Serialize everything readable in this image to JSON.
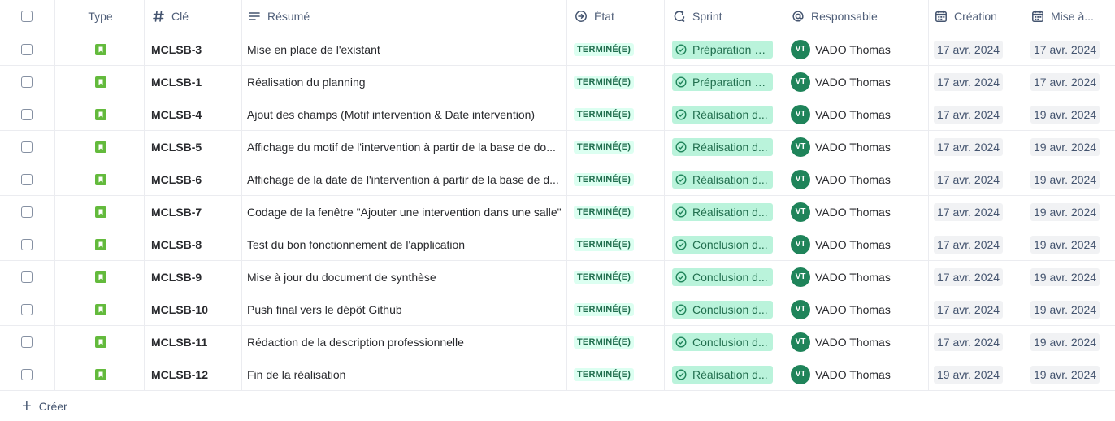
{
  "headers": {
    "type": "Type",
    "key": "Clé",
    "summary": "Résumé",
    "state": "État",
    "sprint": "Sprint",
    "assignee": "Responsable",
    "created": "Création",
    "updated": "Mise à..."
  },
  "icons": {
    "type": "story-icon",
    "key": "hash-icon",
    "summary": "text-lines-icon",
    "state": "arrow-circle-icon",
    "sprint": "sprint-cycle-icon",
    "assignee": "at-icon",
    "created": "calendar-icon",
    "updated": "calendar-icon"
  },
  "colors": {
    "story_green": "#63ba3c",
    "done_lozenge_bg": "#dcfff1",
    "done_lozenge_text": "#216e4e",
    "sprint_pill_bg": "#baf3db",
    "avatar_bg": "#1f845a"
  },
  "rows": [
    {
      "key": "MCLSB-3",
      "summary": "Mise en place de l'existant",
      "state": "TERMINÉ(E)",
      "sprint": "Préparation à...",
      "avatar": "VT",
      "assignee": "VADO Thomas",
      "created": "17 avr. 2024",
      "updated": "17 avr. 2024"
    },
    {
      "key": "MCLSB-1",
      "summary": "Réalisation du planning",
      "state": "TERMINÉ(E)",
      "sprint": "Préparation à...",
      "avatar": "VT",
      "assignee": "VADO Thomas",
      "created": "17 avr. 2024",
      "updated": "17 avr. 2024"
    },
    {
      "key": "MCLSB-4",
      "summary": "Ajout des champs (Motif intervention & Date intervention)",
      "state": "TERMINÉ(E)",
      "sprint": "Réalisation d...",
      "avatar": "VT",
      "assignee": "VADO Thomas",
      "created": "17 avr. 2024",
      "updated": "19 avr. 2024"
    },
    {
      "key": "MCLSB-5",
      "summary": "Affichage du motif de l'intervention à partir de la base de do...",
      "state": "TERMINÉ(E)",
      "sprint": "Réalisation d...",
      "avatar": "VT",
      "assignee": "VADO Thomas",
      "created": "17 avr. 2024",
      "updated": "19 avr. 2024"
    },
    {
      "key": "MCLSB-6",
      "summary": "Affichage de la date de l'intervention à partir de la base de d...",
      "state": "TERMINÉ(E)",
      "sprint": "Réalisation d...",
      "avatar": "VT",
      "assignee": "VADO Thomas",
      "created": "17 avr. 2024",
      "updated": "19 avr. 2024"
    },
    {
      "key": "MCLSB-7",
      "summary": "Codage de la fenêtre \"Ajouter une intervention dans une salle\"",
      "state": "TERMINÉ(E)",
      "sprint": "Réalisation d...",
      "avatar": "VT",
      "assignee": "VADO Thomas",
      "created": "17 avr. 2024",
      "updated": "19 avr. 2024"
    },
    {
      "key": "MCLSB-8",
      "summary": "Test du bon fonctionnement de l'application",
      "state": "TERMINÉ(E)",
      "sprint": "Conclusion d...",
      "avatar": "VT",
      "assignee": "VADO Thomas",
      "created": "17 avr. 2024",
      "updated": "19 avr. 2024"
    },
    {
      "key": "MCLSB-9",
      "summary": "Mise à jour du document de synthèse",
      "state": "TERMINÉ(E)",
      "sprint": "Conclusion d...",
      "avatar": "VT",
      "assignee": "VADO Thomas",
      "created": "17 avr. 2024",
      "updated": "19 avr. 2024"
    },
    {
      "key": "MCLSB-10",
      "summary": "Push final vers le dépôt Github",
      "state": "TERMINÉ(E)",
      "sprint": "Conclusion d...",
      "avatar": "VT",
      "assignee": "VADO Thomas",
      "created": "17 avr. 2024",
      "updated": "19 avr. 2024"
    },
    {
      "key": "MCLSB-11",
      "summary": "Rédaction de la description professionnelle",
      "state": "TERMINÉ(E)",
      "sprint": "Conclusion d...",
      "avatar": "VT",
      "assignee": "VADO Thomas",
      "created": "17 avr. 2024",
      "updated": "19 avr. 2024"
    },
    {
      "key": "MCLSB-12",
      "summary": "Fin de la réalisation",
      "state": "TERMINÉ(E)",
      "sprint": "Réalisation d...",
      "avatar": "VT",
      "assignee": "VADO Thomas",
      "created": "19 avr. 2024",
      "updated": "19 avr. 2024"
    }
  ],
  "create": {
    "label": "Créer"
  }
}
